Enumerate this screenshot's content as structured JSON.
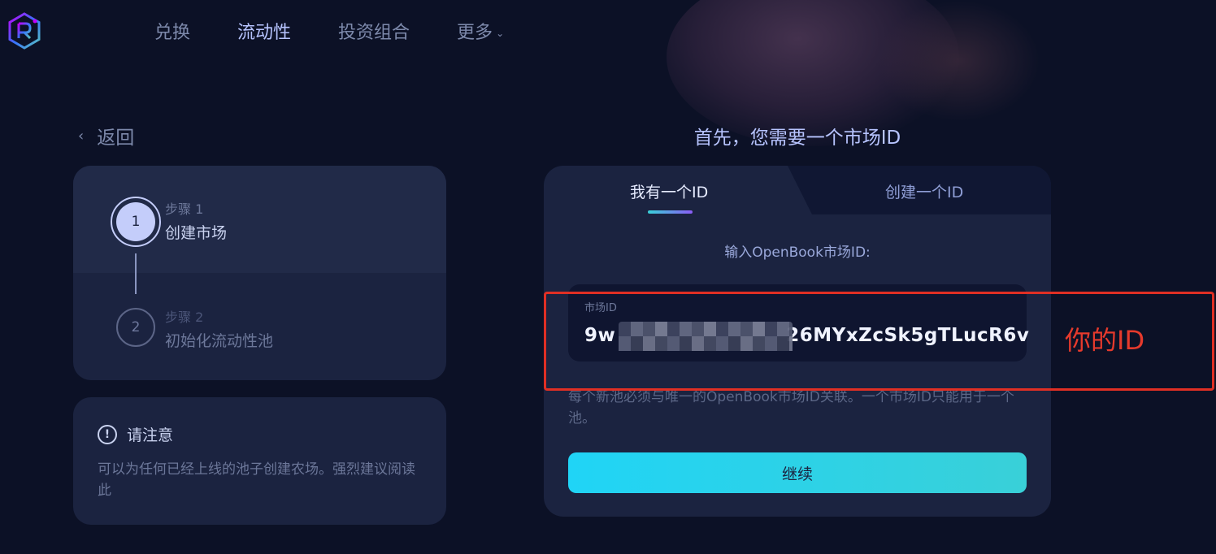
{
  "header": {
    "logo_icon": "raydium-logo-icon",
    "nav": [
      {
        "label": "兑换",
        "active": false
      },
      {
        "label": "流动性",
        "active": true
      },
      {
        "label": "投资组合",
        "active": false
      },
      {
        "label": "更多",
        "active": false,
        "has_dropdown": true
      }
    ]
  },
  "back": {
    "label": "返回"
  },
  "steps": [
    {
      "number": "1",
      "label": "步骤 1",
      "title": "创建市场",
      "active": true
    },
    {
      "number": "2",
      "label": "步骤 2",
      "title": "初始化流动性池",
      "active": false
    }
  ],
  "notice": {
    "title": "请注意",
    "text": "可以为任何已经上线的池子创建农场。强烈建议阅读此"
  },
  "main": {
    "title": "首先，您需要一个市场ID",
    "tabs": [
      {
        "label": "我有一个ID",
        "active": true
      },
      {
        "label": "创建一个ID",
        "active": false
      }
    ],
    "input_label": "输入OpenBook市场ID:",
    "market_id_label": "市场ID",
    "market_id_prefix": "9w",
    "market_id_suffix": "26MYxZcSk5gTLucR6v",
    "help_text": "每个新池必须与唯一的OpenBook市场ID关联。一个市场ID只能用于一个池。",
    "continue_label": "继续"
  },
  "annotation": {
    "text": "你的ID",
    "color": "#e02f24"
  },
  "colors": {
    "background": "#0c1126",
    "card": "#1b2340",
    "accent": "#b7c4ff",
    "button_gradient_start": "#20d4f6",
    "button_gradient_end": "#39d0d8"
  }
}
